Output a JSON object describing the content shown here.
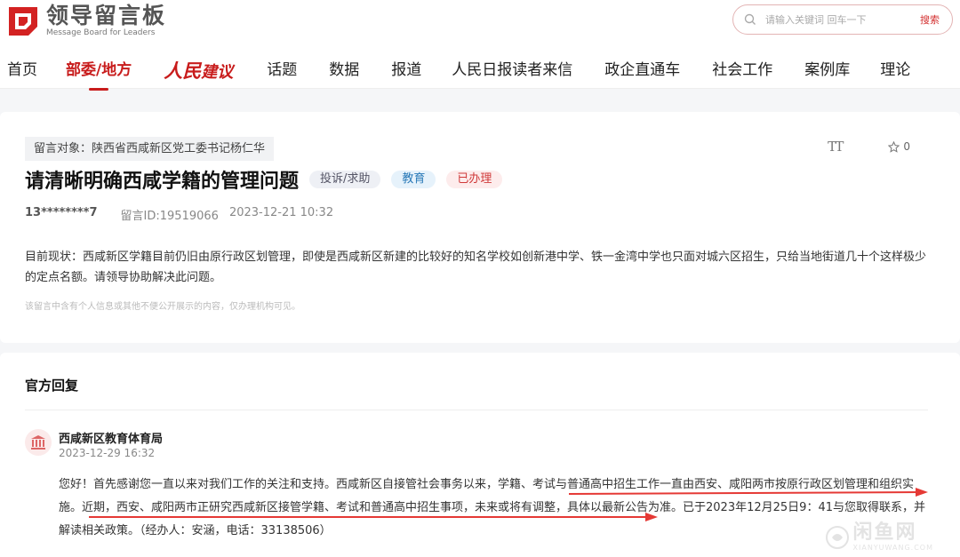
{
  "site": {
    "logo_cn": "领导留言板",
    "logo_en": "Message Board for Leaders",
    "search_placeholder": "请输入关键词 回车一下",
    "search_button": "搜索"
  },
  "nav": [
    {
      "label": "首页",
      "active": false
    },
    {
      "label": "部委/地方",
      "active": true
    },
    {
      "label": "人民建议",
      "special": true
    },
    {
      "label": "话题"
    },
    {
      "label": "数据"
    },
    {
      "label": "报道"
    },
    {
      "label": "人民日报读者来信"
    },
    {
      "label": "政企直通车"
    },
    {
      "label": "社会工作"
    },
    {
      "label": "案例库"
    },
    {
      "label": "理论"
    }
  ],
  "message": {
    "recipient": "留言对象：陕西省西咸新区党工委书记杨仁华",
    "font_tool": "TT",
    "likes": "0",
    "title": "请清晰明确西咸学籍的管理问题",
    "tags": {
      "type": "投诉/求助",
      "category": "教育",
      "status": "已办理"
    },
    "user": "13********7",
    "message_id": "留言ID:19519066",
    "datetime": "2023-12-21 10:32",
    "body": "目前现状：西咸新区学籍目前仍旧由原行政区划管理，即使是西咸新区新建的比较好的知名学校如创新港中学、铁一金湾中学也只面对城六区招生，只给当地街道几十个这样极少的定点名额。请领导协助解决此问题。",
    "privacy_note": "该留言中含有个人信息或其他不便公开展示的内容，仅办理机构可见。"
  },
  "reply": {
    "heading": "官方回复",
    "org_name": "西咸新区教育体育局",
    "org_date": "2023-12-29 16:32",
    "text": "您好！首先感谢您一直以来对我们工作的关注和支持。西咸新区自接管社会事务以来，学籍、考试与普通高中招生工作一直由西安、咸阳两市按原行政区划管理和组织实施。近期，西安、咸阳两市正研究西咸新区接管学籍、考试和普通高中招生事项，未来或将有调整，具体以最新公告为准。已于2023年12月25日9：41与您取得联系，并解读相关政策。（经办人：安涵，电话：33138506）"
  },
  "watermark": {
    "cn": "闲鱼网",
    "en": "XIANYUWANG.COM"
  },
  "colors": {
    "brand_red": "#c81c1c",
    "annotation_red": "#e53935"
  }
}
